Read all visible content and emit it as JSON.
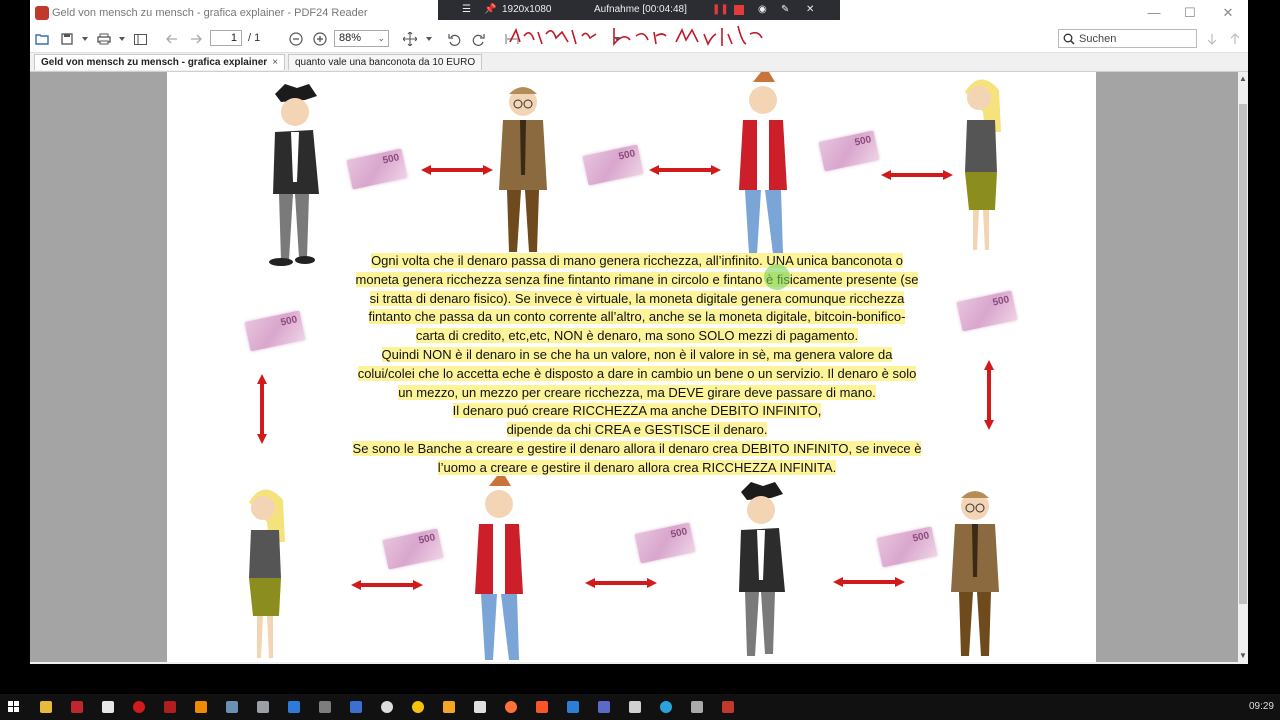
{
  "window": {
    "title": "Geld von mensch zu mensch - grafica explainer - PDF24 Reader",
    "minimize": "—",
    "maximize": "☐",
    "close": "✕"
  },
  "recorder": {
    "resolution": "1920x1080",
    "status": "Aufnahme [00:04:48]"
  },
  "toolbar": {
    "page_current": "1",
    "page_total": "/ 1",
    "zoom": "88%",
    "search_placeholder": "Suchen"
  },
  "tabs": [
    {
      "label": "Geld von mensch zu mensch - grafica explainer",
      "close": "×"
    },
    {
      "label": "quanto vale una banconota da 10 EURO"
    }
  ],
  "document": {
    "banknote_value": "500",
    "lines": [
      "Ogni volta che il denaro passa di mano genera ricchezza, all’infinito. UNA unica banconota o",
      "moneta genera ricchezza senza fine fintanto rimane in circolo e fintano è fisicamente presente (se",
      "si tratta di denaro fisico). Se invece è virtuale, la moneta digitale genera comunque ricchezza",
      "fintanto che passa da un conto corrente all’altro, anche se la moneta digitale, bitcoin-bonifico-",
      "carta di credito, etc,etc, NON è denaro, ma sono SOLO mezzi di pagamento.",
      "Quindi NON è il denaro in se che ha un valore, non è il valore in sè, ma genera valore da",
      "colui/colei che lo accetta eche è disposto a dare in cambio un bene o un servizio. Il denaro è solo",
      "un mezzo, un mezzo per creare ricchezza, ma DEVE girare deve passare di mano.",
      "Il denaro puó creare RICCHEZZA ma anche DEBITO INFINITO,",
      "dipende da chi CREA e GESTISCE il denaro.",
      "Se sono le Banche a creare e gestire il denaro allora il denaro crea DEBITO INFINITO, se invece è",
      "l’uomo a creare e gestire il denaro allora crea RICCHEZZA INFINITA."
    ]
  },
  "taskbar": {
    "clock": "09:29"
  },
  "colors": {
    "highlight": "#fdf49a",
    "arrow": "#d11a1a",
    "annotation_ink": "#c0182a"
  }
}
